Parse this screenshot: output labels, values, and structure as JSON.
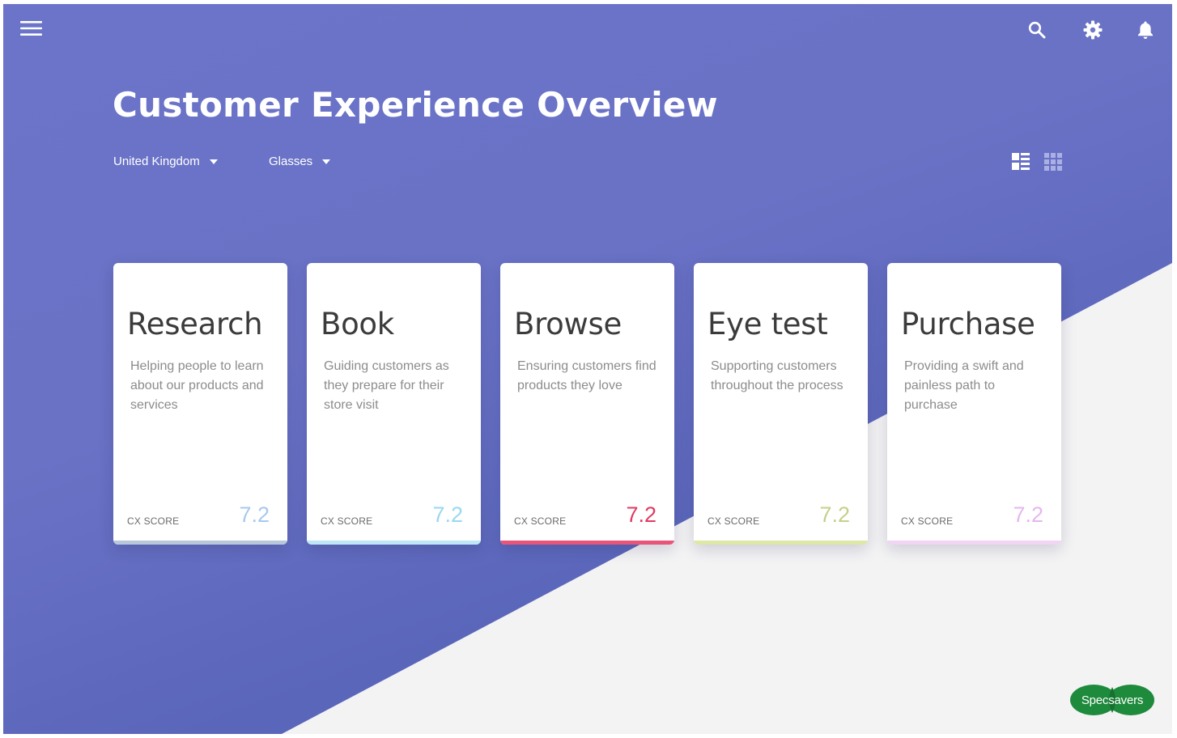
{
  "header": {
    "menu_icon": "hamburger-menu-icon",
    "search_icon": "search-icon",
    "settings_icon": "gear-icon",
    "notifications_icon": "bell-icon"
  },
  "page": {
    "title": "Customer Experience Overview"
  },
  "filters": {
    "country": "United Kingdom",
    "product": "Glasses"
  },
  "view_toggle": {
    "list_view_icon": "list-view-icon",
    "grid_view_icon": "grid-view-icon"
  },
  "cards": [
    {
      "title": "Research",
      "description": "Helping people to learn about our products and services",
      "score_label": "CX SCORE",
      "score": "7.2",
      "accent": "#a9c8ee",
      "bar": "#b9c7da"
    },
    {
      "title": "Book",
      "description": "Guiding customers as they prepare for their store visit",
      "score_label": "CX SCORE",
      "score": "7.2",
      "accent": "#9ad7f3",
      "bar": "#bfe7f7"
    },
    {
      "title": "Browse",
      "description": "Ensuring customers find products they love",
      "score_label": "CX SCORE",
      "score": "7.2",
      "accent": "#e03a62",
      "bar": "#e9557a"
    },
    {
      "title": "Eye test",
      "description": "Supporting customers throughout the process",
      "score_label": "CX SCORE",
      "score": "7.2",
      "accent": "#c6cf8a",
      "bar": "#dde8a6"
    },
    {
      "title": "Purchase",
      "description": "Providing a swift and painless path to purchase",
      "score_label": "CX SCORE",
      "score": "7.2",
      "accent": "#e6b7ef",
      "bar": "#f2d4f5"
    }
  ],
  "brand": {
    "logo_text": "Specsavers",
    "logo_color": "#1e8a3c"
  },
  "colors": {
    "background_gradient_start": "#6b74c8",
    "background_gradient_end": "#4e5fb0",
    "diagonal_panel": "#f3f3f4"
  }
}
